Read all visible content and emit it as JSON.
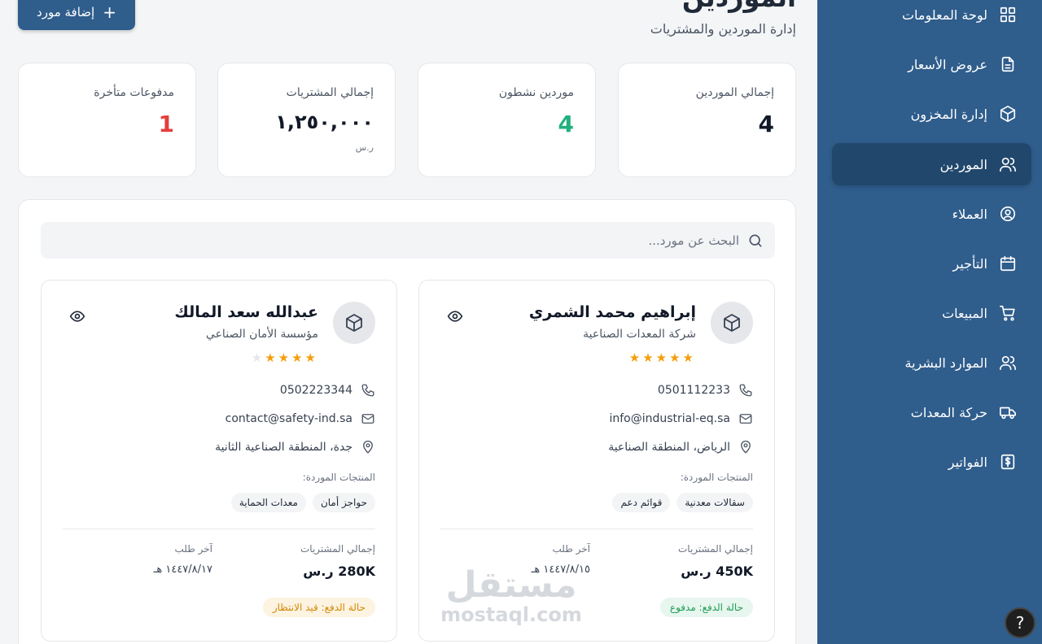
{
  "sidebar": {
    "items": [
      {
        "label": "لوحة المعلومات",
        "icon": "dashboard-icon"
      },
      {
        "label": "عروض الأسعار",
        "icon": "document-icon"
      },
      {
        "label": "إدارة المخزون",
        "icon": "box-icon"
      },
      {
        "label": "الموردين",
        "icon": "users-icon",
        "active": true
      },
      {
        "label": "العملاء",
        "icon": "user-circle-icon"
      },
      {
        "label": "التأجير",
        "icon": "calendar-icon"
      },
      {
        "label": "المبيعات",
        "icon": "cart-icon"
      },
      {
        "label": "الموارد البشرية",
        "icon": "users-icon"
      },
      {
        "label": "حركة المعدات",
        "icon": "truck-icon"
      },
      {
        "label": "الفواتير",
        "icon": "dollar-icon"
      }
    ]
  },
  "header": {
    "title": "الموردين",
    "subtitle": "إدارة الموردين والمشتريات",
    "add_button": "إضافة مورد"
  },
  "stats": [
    {
      "label": "إجمالي الموردين",
      "value": "4",
      "color": "#111827"
    },
    {
      "label": "موردين نشطون",
      "value": "4",
      "color": "#22b07d"
    },
    {
      "label": "إجمالي المشتريات",
      "value": "١,٢٥٠,٠٠٠",
      "unit": "ر.س",
      "color": "#111827"
    },
    {
      "label": "مدفوعات متأخرة",
      "value": "1",
      "color": "#e53e3e"
    }
  ],
  "search": {
    "placeholder": "البحث عن مورد..."
  },
  "suppliers": [
    {
      "name": "إبراهيم محمد الشمري",
      "company": "شركة المعدات الصناعية",
      "rating": 5,
      "phone": "0501112233",
      "email": "info@industrial-eq.sa",
      "address": "الرياض، المنطقة الصناعية",
      "products_label": "المنتجات الموردة:",
      "products": [
        "سقالات معدنية",
        "قوائم دعم"
      ],
      "total_label": "إجمالي المشتريات",
      "total": "450K ر.س",
      "last_order_label": "آخر طلب",
      "last_order": "١٤٤٧/٨/١٥ هـ",
      "status": "حالة الدفع: مدفوع",
      "status_type": "paid"
    },
    {
      "name": "عبدالله سعد المالك",
      "company": "مؤسسة الأمان الصناعي",
      "rating": 4,
      "phone": "0502223344",
      "email": "contact@safety-ind.sa",
      "address": "جدة، المنطقة الصناعية الثانية",
      "products_label": "المنتجات الموردة:",
      "products": [
        "حواجز أمان",
        "معدات الحماية"
      ],
      "total_label": "إجمالي المشتريات",
      "total": "280K ر.س",
      "last_order_label": "آخر طلب",
      "last_order": "١٤٤٧/٨/١٧ هـ",
      "status": "حالة الدفع: قيد الانتظار",
      "status_type": "pending"
    }
  ],
  "watermark": {
    "arabic": "مستقل",
    "latin": "mostaql.com"
  },
  "help_label": "?"
}
